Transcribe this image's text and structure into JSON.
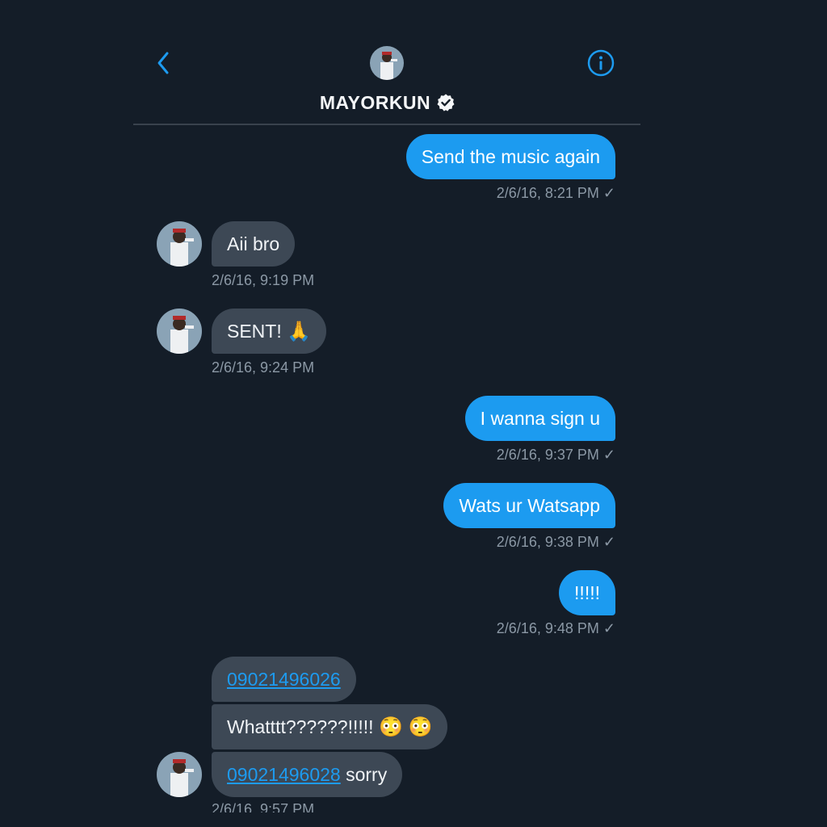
{
  "header": {
    "title": "MAYORKUN",
    "back_icon": "chevron-left-icon",
    "info_icon": "info-circle-icon",
    "verified_icon": "verified-badge-icon"
  },
  "colors": {
    "background": "#141d28",
    "outgoing_bubble": "#1c9bf0",
    "incoming_bubble": "#3d4855",
    "link": "#1d9bf0",
    "timestamp": "#8b98a5"
  },
  "messages": [
    {
      "direction": "outgoing",
      "text": "Send the music again",
      "time": "2/6/16, 8:21 PM"
    },
    {
      "direction": "incoming",
      "text": "Aii bro",
      "time": "2/6/16, 9:19 PM"
    },
    {
      "direction": "incoming",
      "text": "SENT!",
      "emoji": "🙏",
      "time": "2/6/16, 9:24 PM"
    },
    {
      "direction": "outgoing",
      "text": "I wanna sign u",
      "time": "2/6/16, 9:37 PM"
    },
    {
      "direction": "outgoing",
      "text": "Wats ur Watsapp",
      "time": "2/6/16, 9:38 PM"
    },
    {
      "direction": "outgoing",
      "text": "!!!!!",
      "time": "2/6/16, 9:48 PM"
    },
    {
      "direction": "incoming",
      "link": "09021496026"
    },
    {
      "direction": "incoming",
      "text": "Whatttt??????!!!!!",
      "emoji": "😳 😳"
    },
    {
      "direction": "incoming",
      "link": "09021496028",
      "text": "sorry",
      "time": "2/6/16, 9:57 PM"
    }
  ],
  "read_mark": "✓"
}
